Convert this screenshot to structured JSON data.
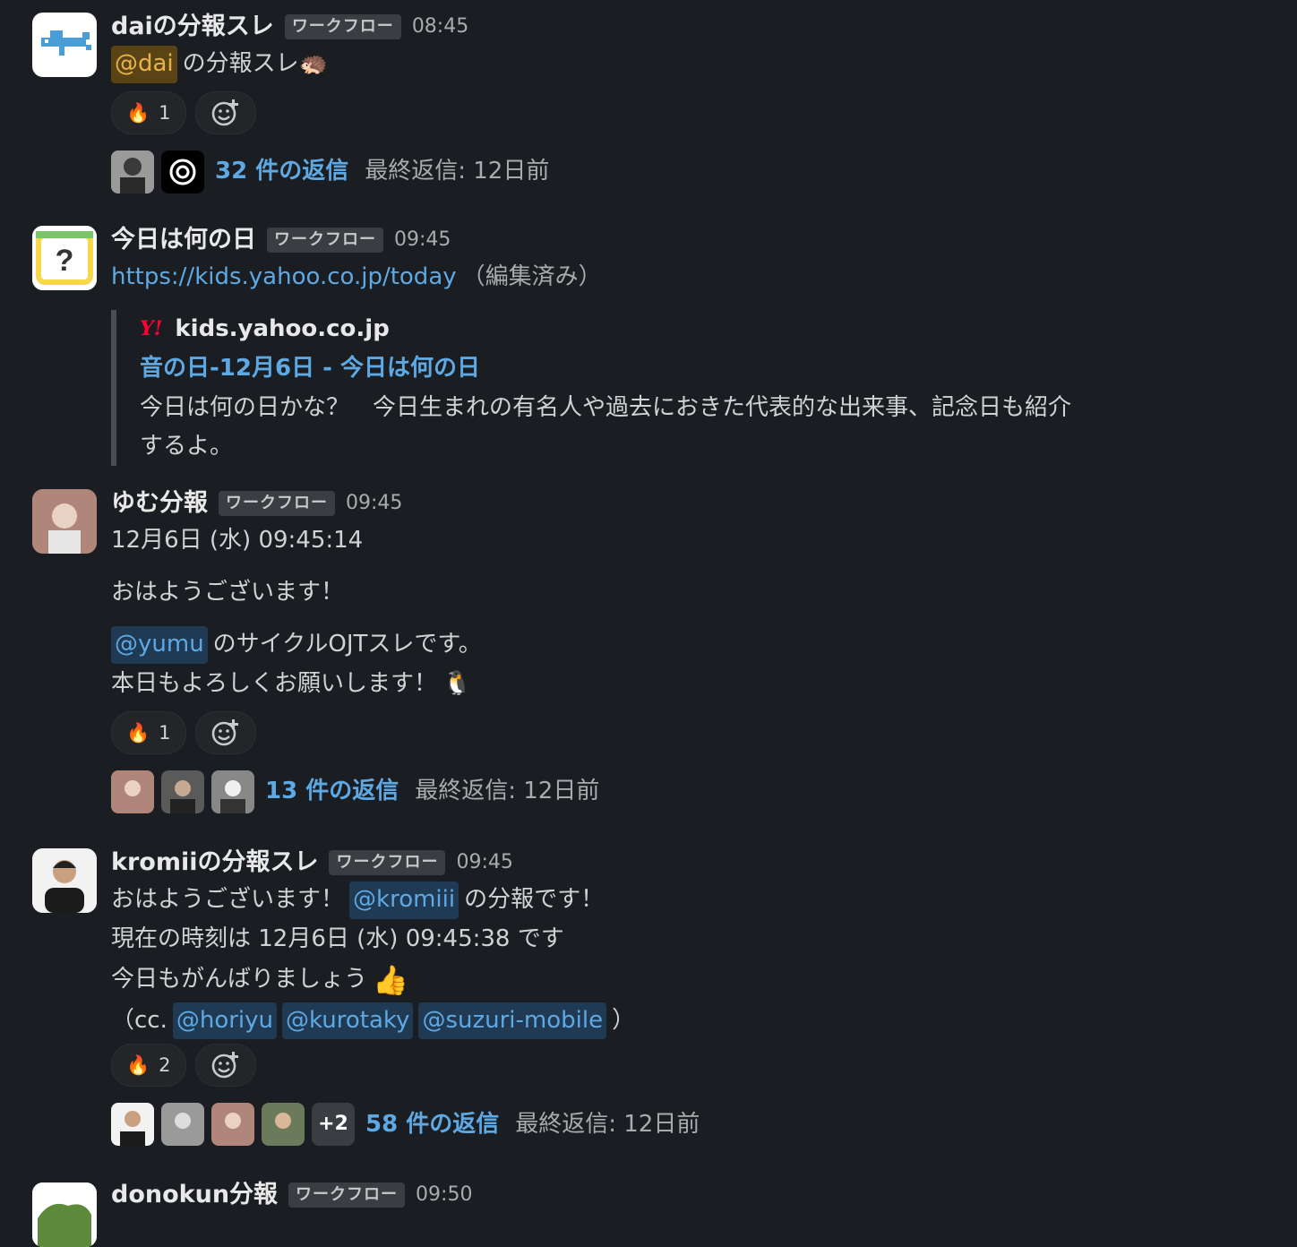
{
  "messages": [
    {
      "author": "daiの分報スレ",
      "badge": "ワークフロー",
      "time": "08:45",
      "mention": "@dai",
      "text": "の分報スレ",
      "emoji": "🦔",
      "reaction": {
        "emoji": "🔥",
        "count": "1"
      },
      "add_reaction_icon": "add-reaction-icon",
      "replies": {
        "count": "32 件の返信",
        "last": "最終返信: 12日前"
      }
    },
    {
      "author": "今日は何の日",
      "badge": "ワークフロー",
      "time": "09:45",
      "link": "https://kids.yahoo.co.jp/today",
      "edited": "（編集済み）",
      "unfurl": {
        "logo": "Y!",
        "site": "kids.yahoo.co.jp",
        "title": "音の日-12月6日 - 今日は何の日",
        "desc_line1": "今日は何の日かな？　今日生まれの有名人や過去におきた代表的な出来事、記念日も紹介",
        "desc_line2": "するよ。"
      }
    },
    {
      "author": "ゆむ分報",
      "badge": "ワークフロー",
      "time": "09:45",
      "line1": "12月6日 (水) 09:45:14",
      "line2": "おはようございます！",
      "mention": "@yumu",
      "line3": "のサイクルOJTスレです。",
      "line4": "本日もよろしくお願いします！",
      "emoji": "🐧",
      "reaction": {
        "emoji": "🔥",
        "count": "1"
      },
      "replies": {
        "count": "13 件の返信",
        "last": "最終返信: 12日前"
      }
    },
    {
      "author": "kromiiの分報スレ",
      "badge": "ワークフロー",
      "time": "09:45",
      "line1_a": "おはようございます！",
      "mention": "@kromiii",
      "line1_b": "の分報です！",
      "line2": "現在の時刻は 12月6日 (水) 09:45:38 です",
      "line3": "今日もがんばりましょう",
      "emoji": "👍",
      "cc_open": "（cc.",
      "cc_mentions": [
        "@horiyu",
        "@kurotaky",
        "@suzuri-mobile"
      ],
      "cc_close": "）",
      "reaction": {
        "emoji": "🔥",
        "count": "2"
      },
      "replies": {
        "count": "58 件の返信",
        "last": "最終返信: 12日前",
        "more": "+2"
      }
    },
    {
      "author": "donokun分報",
      "badge": "ワークフロー",
      "time": "09:50"
    }
  ],
  "colors": {
    "background": "#1a1d21",
    "link": "#5ea9e4",
    "mention_bg": "#1f3a52",
    "self_mention_bg": "#5a4416"
  }
}
